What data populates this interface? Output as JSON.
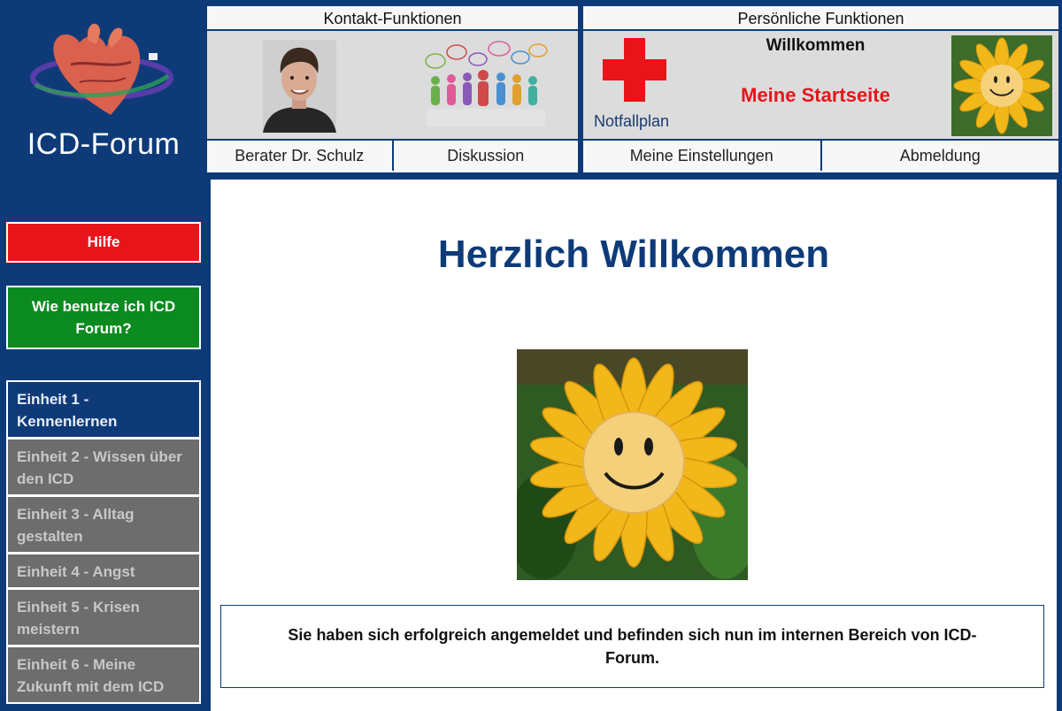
{
  "sidebar": {
    "brand": "ICD-Forum",
    "help_label": "Hilfe",
    "howto_label": "Wie benutze ich ICD Forum?",
    "units": [
      {
        "label": "Einheit 1 - Kennenlernen",
        "active": true
      },
      {
        "label": "Einheit 2 - Wissen über den ICD",
        "active": false
      },
      {
        "label": "Einheit 3 - Alltag gestalten",
        "active": false
      },
      {
        "label": "Einheit 4 - Angst",
        "active": false
      },
      {
        "label": "Einheit 5 - Krisen meistern",
        "active": false
      },
      {
        "label": "Einheit 6 - Meine Zukunft mit dem ICD",
        "active": false
      }
    ]
  },
  "contact": {
    "title": "Kontakt-Funktionen",
    "advisor_label": "Berater Dr. Schulz",
    "discussion_label": "Diskussion"
  },
  "personal": {
    "title": "Persönliche Funktionen",
    "emergency_label": "Notfallplan",
    "welcome_label": "Willkommen",
    "startpage_label": "Meine Startseite",
    "settings_label": "Meine Einstellungen",
    "logout_label": "Abmeldung"
  },
  "main": {
    "title": "Herzlich Willkommen",
    "notice": "Sie haben sich erfolgreich angemeldet und befinden sich nun im internen Bereich von ICD-Forum."
  },
  "colors": {
    "navy": "#0e3b78",
    "help_red": "#e8141a",
    "howto_green": "#0b8a1f",
    "unit_grey": "#6d6d6d",
    "startpage_red": "#e8141a"
  },
  "icons": {
    "logo": "heart-logo-icon",
    "emergency": "red-cross-icon",
    "profile": "sunflower-smiley-icon",
    "discussion": "people-speech-bubbles-icon"
  }
}
